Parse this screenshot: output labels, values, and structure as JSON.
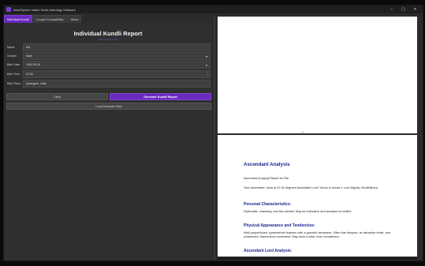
{
  "window": {
    "title": "AstroSyntec Indian Vedic Astrology Software",
    "controls": {
      "minimize": "–",
      "maximize": "▢",
      "close": "✕"
    }
  },
  "tabs": [
    {
      "label": "Individual Kundli",
      "active": true
    },
    {
      "label": "Couple Compatibility",
      "active": false
    },
    {
      "label": "About",
      "active": false
    }
  ],
  "form": {
    "title": "Individual Kundli Report",
    "subtitle": "AstroSyntec Kundli",
    "fields": {
      "name": {
        "label": "Name:",
        "value": "Rai"
      },
      "gender": {
        "label": "Gender:",
        "value": "Male"
      },
      "birth_date": {
        "label": "Birth Date:",
        "value": "1992-05-26"
      },
      "birth_time": {
        "label": "Birth Time:",
        "value": "22:30"
      },
      "birth_place": {
        "label": "Birth Place:",
        "value": "Azamgarh, India"
      }
    },
    "buttons": {
      "clear": "Clear",
      "generate": "Generate Kundli Report",
      "example": "Load Example Data"
    }
  },
  "report": {
    "heading": "Ascendant Analysis",
    "intro": "Ascendant (Lagna) Report for Rai",
    "summary": "Your Ascendant: Libra at 22.92 degrees Ascendant Lord: Venus in House 1 Lord Dignity: Moolthikona",
    "sections": [
      {
        "title": "Personal Characteristics:",
        "text": "Diplomatic, charming, and fair-minded. May be indecisive and avoidant of conflict."
      },
      {
        "title": "Physical Appearance and Tendencies:",
        "text": "Well-proportioned, symmetrical features with a graceful demeanor. Often has dimples, an attractive smile, and a balanced, harmonious movement. May have a clear, even complexion."
      },
      {
        "title": "Ascendant Lord Analysis:",
        "text": ""
      }
    ]
  }
}
